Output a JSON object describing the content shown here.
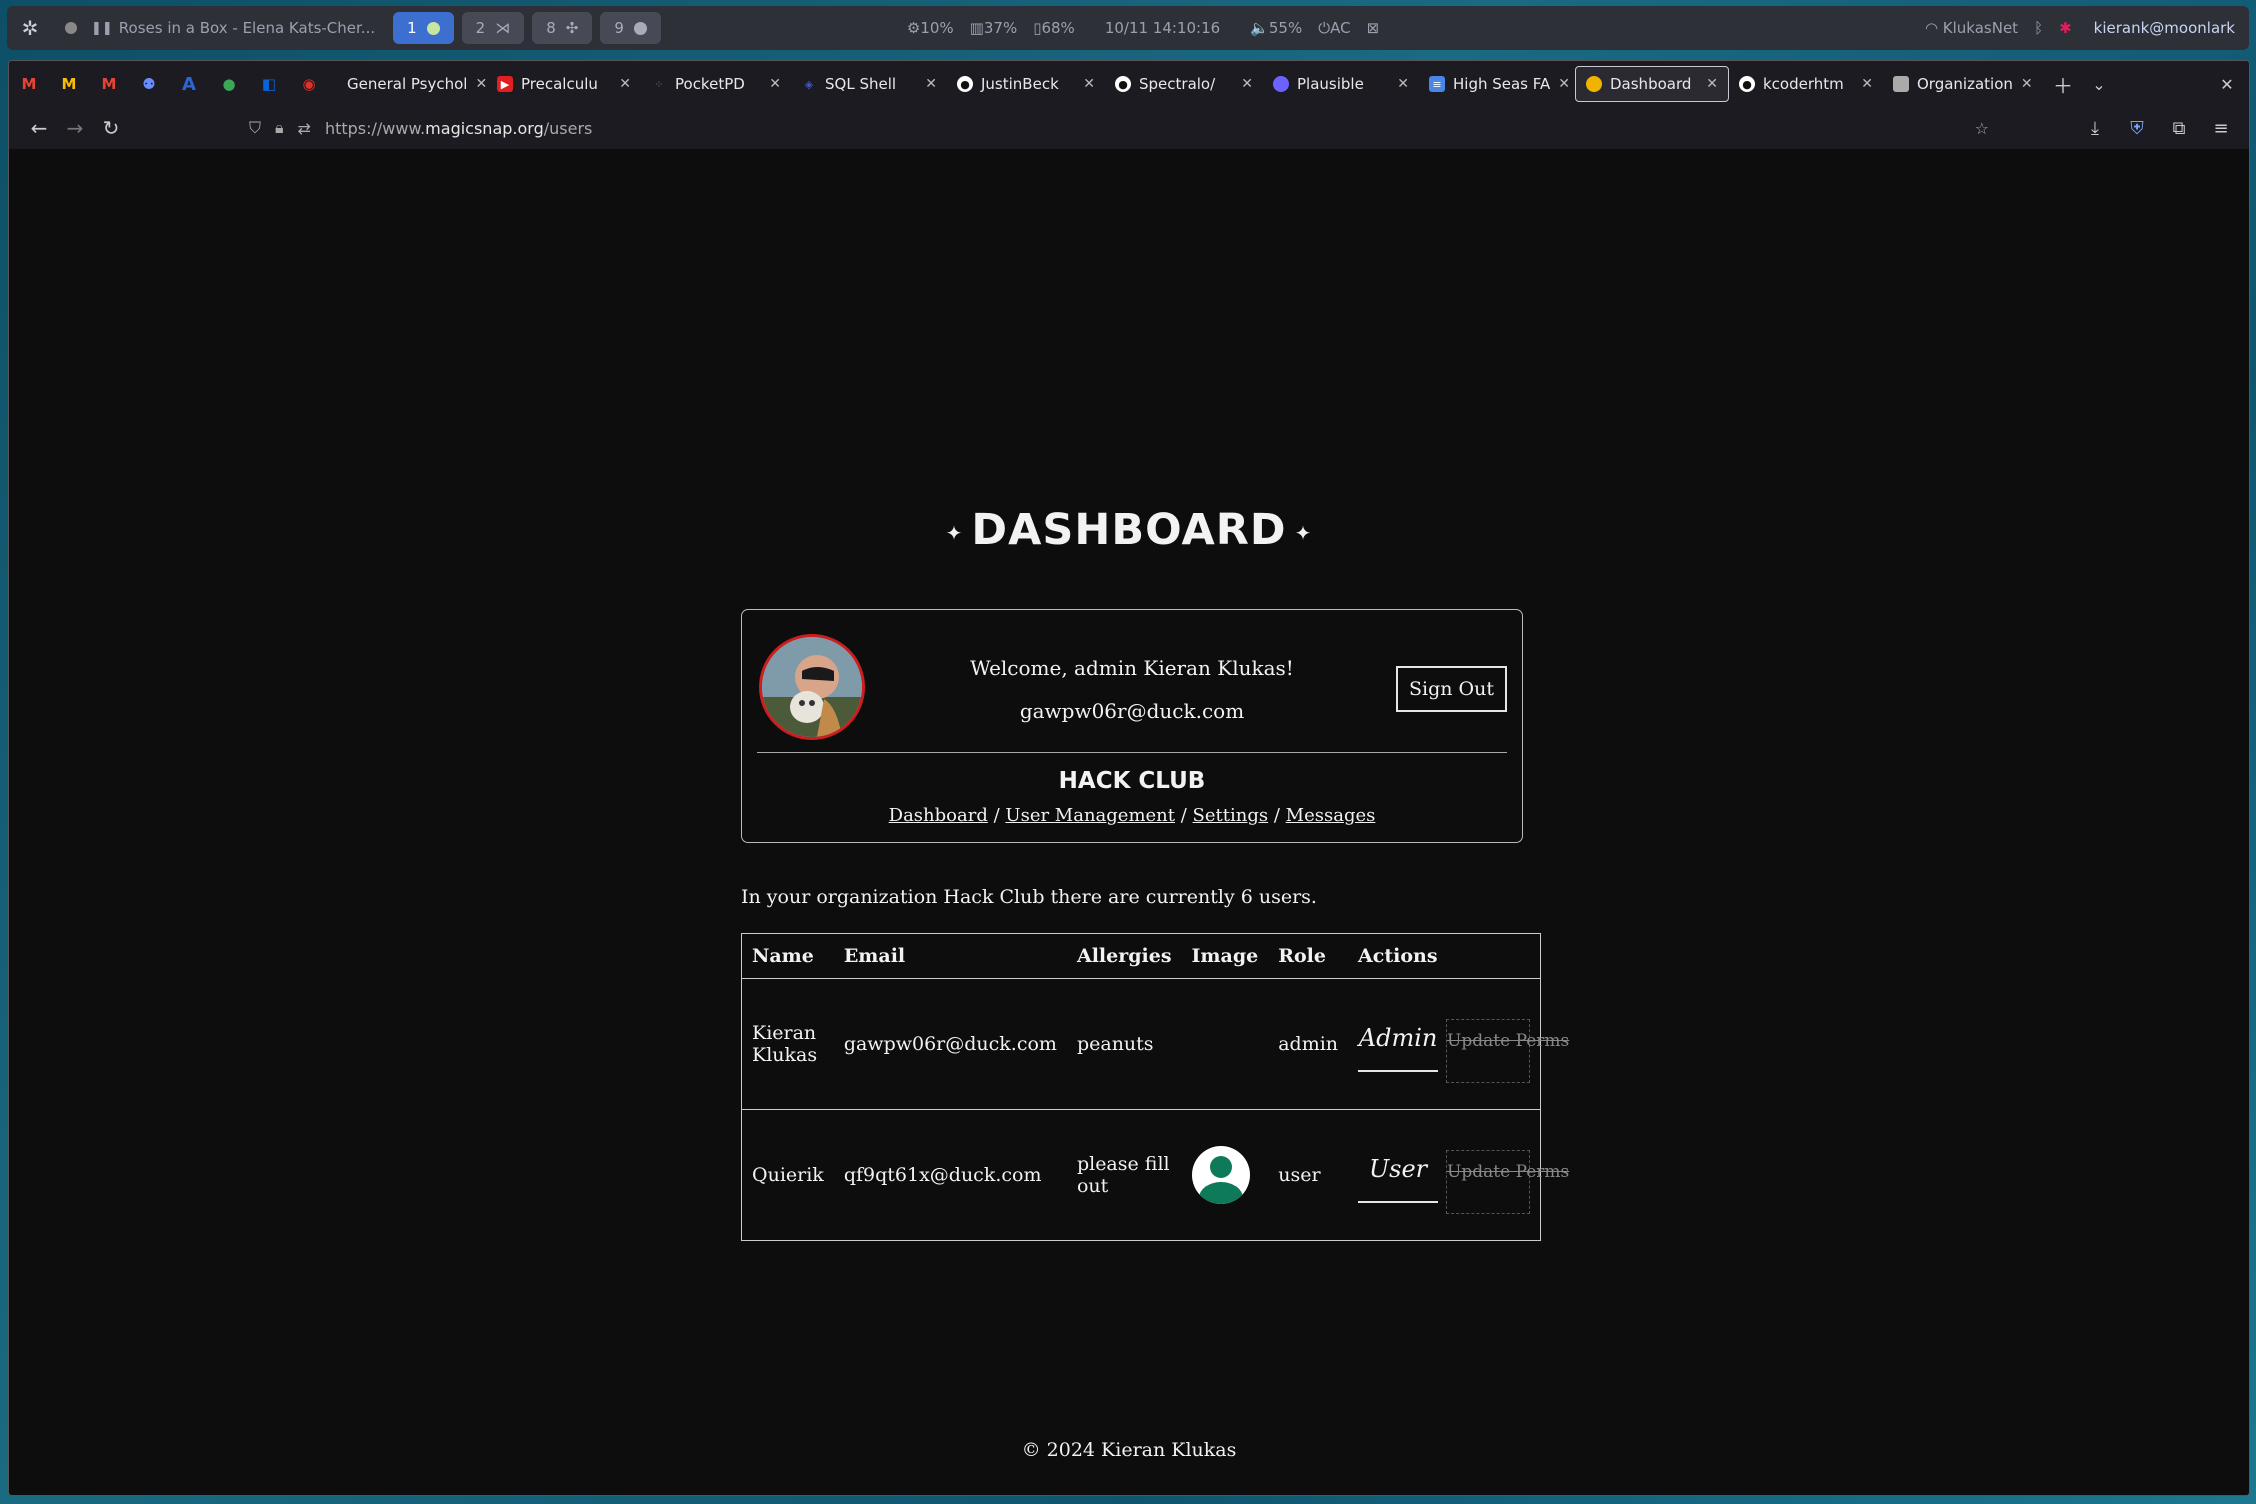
{
  "system_bar": {
    "media": "Roses in a Box - Elena Kats-Cher...",
    "workspaces": [
      "1",
      "2",
      "8",
      "9"
    ],
    "cpu": "10%",
    "mem": "37%",
    "battery": "68%",
    "datetime": "10/11 14:10:16",
    "volume": "55%",
    "power": "AC",
    "network": "KlukasNet",
    "user": "kierank@moonlark"
  },
  "tabs": [
    {
      "label": "General Psychol",
      "icon_color": "#2aa6d9"
    },
    {
      "label": "Precalculu",
      "icon_color": "#e02020"
    },
    {
      "label": "PocketPD",
      "icon_color": "#777777"
    },
    {
      "label": "SQL Shell",
      "icon_color": "#4058c8"
    },
    {
      "label": "JustinBeck",
      "icon_color": "#ffffff"
    },
    {
      "label": "Spectralo/",
      "icon_color": "#ffffff"
    },
    {
      "label": "Plausible",
      "icon_color": "#6c63ff"
    },
    {
      "label": "High Seas FA",
      "icon_color": "#4a86e8"
    },
    {
      "label": "Dashboard",
      "icon_color": "#f0b400"
    },
    {
      "label": "kcoderhtm",
      "icon_color": "#ffffff"
    },
    {
      "label": "Organization",
      "icon_color": "#aaaaaa"
    }
  ],
  "url": {
    "prefix": "https://www.",
    "host": "magicsnap.org",
    "path": "/users"
  },
  "dashboard": {
    "title": "DASHBOARD",
    "spark": "✦",
    "welcome": "Welcome, admin Kieran Klukas!",
    "email": "gawpw06r@duck.com",
    "signout": "Sign Out",
    "org_name": "HACK CLUB",
    "nav": [
      "Dashboard",
      "User Management",
      "Settings",
      "Messages"
    ],
    "nav_sep": "/",
    "org_info": "In your organization Hack Club there are currently 6 users."
  },
  "table": {
    "headers": [
      "Name",
      "Email",
      "Allergies",
      "Image",
      "Role",
      "Actions"
    ],
    "rows": [
      {
        "name": "Kieran Klukas",
        "email": "gawpw06r@duck.com",
        "allergies": "peanuts",
        "role": "admin",
        "role_button": "Admin",
        "perm_button": "Update Perms"
      },
      {
        "name": "Quierik",
        "email": "qf9qt61x@duck.com",
        "allergies": "please fill out",
        "role": "user",
        "role_button": "User",
        "perm_button": "Update Perms"
      }
    ]
  },
  "footer": "© 2024 Kieran Klukas"
}
